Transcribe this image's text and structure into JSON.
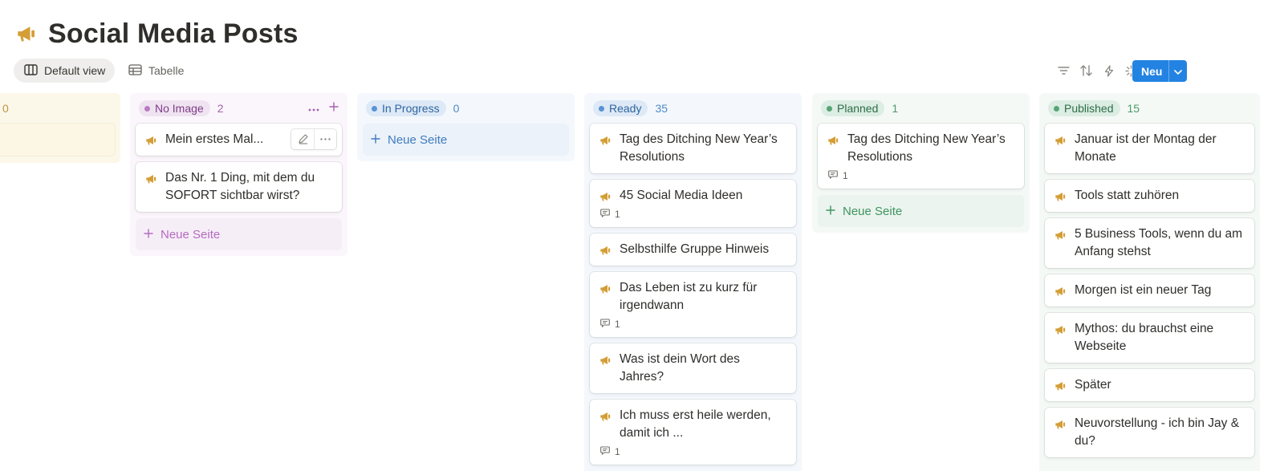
{
  "page": {
    "title": "Social Media Posts",
    "icon": "megaphone-icon"
  },
  "views": [
    {
      "label": "Default view",
      "icon": "board-view-icon",
      "active": true
    },
    {
      "label": "Tabelle",
      "icon": "table-view-icon",
      "active": false
    }
  ],
  "toolbar": {
    "icons": [
      "filter-icon",
      "sort-icon",
      "automation-icon",
      "ai-icon",
      "search-icon",
      "settings-icon"
    ],
    "new_label": "Neu"
  },
  "columns": [
    {
      "key": "hidden",
      "label": "",
      "count": "0",
      "colors": {
        "bg": "#fbf8ea",
        "pill": "#f4ecd0",
        "text": "#c29343",
        "dot": "#c29343"
      },
      "cards": []
    },
    {
      "key": "no_image",
      "label": "No Image",
      "count": "2",
      "colors": {
        "bg": "#fbf6fb",
        "pill": "#f0e3f1",
        "text": "#9a4fa6",
        "dot": "#b77cc1",
        "new": "#b36bbf"
      },
      "cards": [
        {
          "title": "Mein erstes Mal...",
          "comments": null
        },
        {
          "title": "Das Nr. 1 Ding, mit dem du SOFORT sichtbar wirst?",
          "comments": null
        }
      ],
      "new_page": "Neue Seite"
    },
    {
      "key": "in_progress",
      "label": "In Progress",
      "count": "0",
      "colors": {
        "bg": "#f4f8fc",
        "pill": "#dde9f6",
        "text": "#3e7bc0",
        "dot": "#5a93d3",
        "new": "#3e7bc0"
      },
      "cards": [],
      "new_page": "Neue Seite"
    },
    {
      "key": "ready",
      "label": "Ready",
      "count": "35",
      "colors": {
        "bg": "#f4f8fc",
        "pill": "#dde9f6",
        "text": "#3e7bc0",
        "dot": "#5a93d3",
        "new": "#3e7bc0"
      },
      "cards": [
        {
          "title": "Tag des Ditching New Year’s Resolutions",
          "comments": null
        },
        {
          "title": "45 Social Media Ideen",
          "comments": "1"
        },
        {
          "title": "Selbsthilfe Gruppe Hinweis",
          "comments": null
        },
        {
          "title": "Das Leben ist zu kurz für irgendwann",
          "comments": "1"
        },
        {
          "title": "Was ist dein Wort des Jahres?",
          "comments": null
        },
        {
          "title": "Ich muss erst heile werden, damit ich ...",
          "comments": "1"
        }
      ]
    },
    {
      "key": "planned",
      "label": "Planned",
      "count": "1",
      "colors": {
        "bg": "#f4f9f6",
        "pill": "#dcede3",
        "text": "#3f8a5c",
        "dot": "#56a575",
        "new": "#3f9460"
      },
      "cards": [
        {
          "title": "Tag des Ditching New Year’s Resolutions",
          "comments": "1"
        }
      ],
      "new_page": "Neue Seite"
    },
    {
      "key": "published",
      "label": "Published",
      "count": "15",
      "colors": {
        "bg": "#f4f9f6",
        "pill": "#dcede3",
        "text": "#3f8a5c",
        "dot": "#56a575",
        "new": "#3f9460"
      },
      "cards": [
        {
          "title": "Januar ist der Montag der Monate",
          "comments": null
        },
        {
          "title": "Tools statt zuhören",
          "comments": null
        },
        {
          "title": "5 Business Tools, wenn du am Anfang stehst",
          "comments": null
        },
        {
          "title": "Morgen ist ein neuer Tag",
          "comments": null
        },
        {
          "title": "Mythos: du brauchst eine Webseite",
          "comments": null
        },
        {
          "title": "Später",
          "comments": null
        },
        {
          "title": "Neuvorstellung - ich bin Jay & du?",
          "comments": null
        }
      ]
    }
  ],
  "colors": {
    "accent": "#2383e2",
    "megaphone": "#d49d35"
  }
}
